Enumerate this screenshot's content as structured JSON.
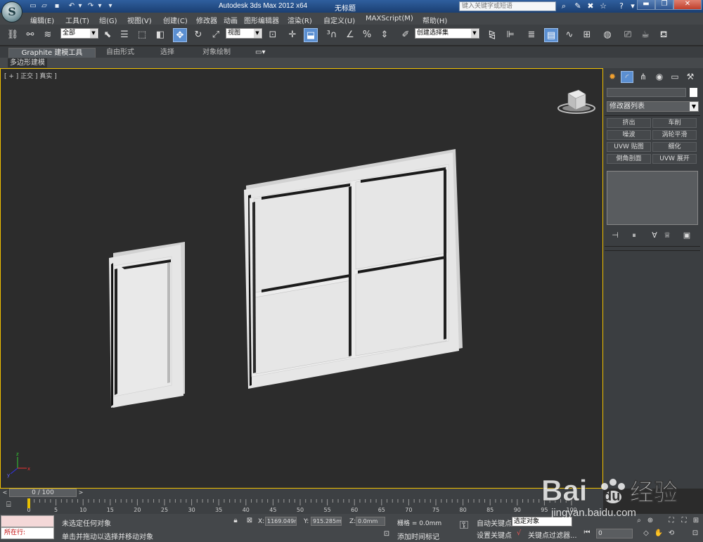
{
  "titlebar": {
    "app_title": "Autodesk 3ds Max  2012 x64",
    "doc_title": "无标题",
    "search_placeholder": "键入关键字或短语",
    "logo_letter": "S"
  },
  "menu": [
    "编辑(E)",
    "工具(T)",
    "组(G)",
    "视图(V)",
    "创建(C)",
    "修改器",
    "动画",
    "图形编辑器",
    "渲染(R)",
    "自定义(U)",
    "MAXScript(M)",
    "帮助(H)"
  ],
  "toolbar": {
    "selection_filter": "全部",
    "ref_coord": "视图",
    "named_selection": "创建选择集"
  },
  "ribbon": {
    "tabs": [
      "Graphite 建模工具",
      "自由形式",
      "选择",
      "对象绘制"
    ],
    "panel_label": "多边形建模"
  },
  "viewport": {
    "label": "[ + ] 正交 ] 真实 ]"
  },
  "command_panel": {
    "modifier_list": "修改器列表",
    "modifier_buttons": [
      "挤出",
      "车削",
      "噪波",
      "涡轮平滑",
      "UVW 贴图",
      "细化",
      "倒角剖面",
      "UVW 展开"
    ]
  },
  "timeline": {
    "frame_display": "0 / 100",
    "ticks": [
      "0",
      "5",
      "10",
      "15",
      "20",
      "25",
      "30",
      "35",
      "40",
      "45",
      "50",
      "55",
      "60",
      "65",
      "70",
      "75",
      "80",
      "85",
      "90",
      "95",
      "100"
    ]
  },
  "status": {
    "now_running": "所在行:",
    "selection_status": "未选定任何对象",
    "prompt": "单击并拖动以选择并移动对象",
    "x_label": "X:",
    "x_value": "1169.049m",
    "y_label": "Y:",
    "y_value": "915.285mm",
    "z_label": "Z:",
    "z_value": "0.0mm",
    "grid": "栅格 = 0.0mm",
    "add_time_tag": "添加时间标记",
    "auto_key": "自动关键点",
    "set_key": "设置关键点",
    "selected_filter": "选定对象",
    "key_filters": "关键点过滤器...",
    "frame_value": "0"
  },
  "watermark": {
    "brand": "Bai",
    "brand2": "du",
    "cn": "经验",
    "url": "jingyan.baidu.com"
  },
  "colors": {
    "accent": "#5b8fd1",
    "viewport_border": "#f2c200",
    "geometry": "#e6e6e6"
  }
}
